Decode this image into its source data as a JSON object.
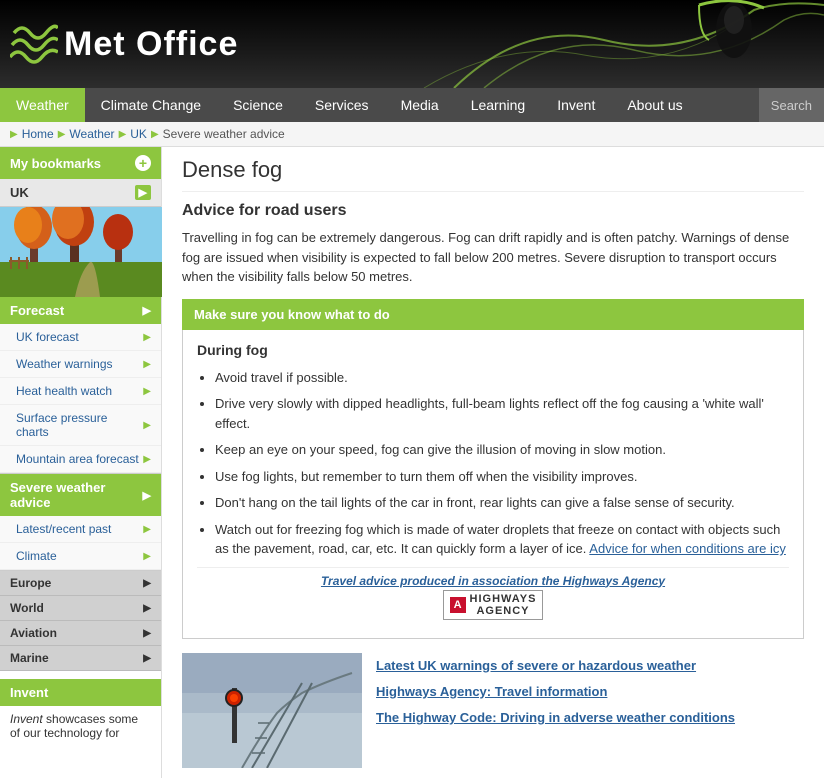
{
  "header": {
    "logo_text": "Met Office",
    "logo_waves": "≋"
  },
  "nav": {
    "items": [
      {
        "label": "Weather",
        "active": true
      },
      {
        "label": "Climate Change",
        "active": false
      },
      {
        "label": "Science",
        "active": false
      },
      {
        "label": "Services",
        "active": false
      },
      {
        "label": "Media",
        "active": false
      },
      {
        "label": "Learning",
        "active": false
      },
      {
        "label": "Invent",
        "active": false
      },
      {
        "label": "About us",
        "active": false
      }
    ],
    "search_label": "Search"
  },
  "breadcrumb": {
    "items": [
      "Home",
      "Weather",
      "UK",
      "Severe weather advice"
    ]
  },
  "sidebar": {
    "bookmarks_label": "My bookmarks",
    "uk_label": "UK",
    "forecast_label": "Forecast",
    "forecast_items": [
      {
        "label": "UK forecast"
      },
      {
        "label": "Weather warnings"
      },
      {
        "label": "Heat health watch"
      },
      {
        "label": "Surface pressure charts"
      },
      {
        "label": "Mountain area forecast"
      }
    ],
    "severe_label": "Severe weather advice",
    "other_items": [
      {
        "label": "Latest/recent past"
      },
      {
        "label": "Climate"
      }
    ],
    "europe_label": "Europe",
    "world_label": "World",
    "aviation_label": "Aviation",
    "marine_label": "Marine",
    "invent_label": "Invent",
    "invent_text": "Invent showcases some of our technology for"
  },
  "main": {
    "page_title": "Dense fog",
    "section_title": "Advice for road users",
    "intro": "Travelling in fog can be extremely dangerous. Fog can drift rapidly and is often patchy. Warnings of dense fog are issued when visibility is expected to fall below 200 metres. Severe disruption to transport occurs when the visibility falls below 50 metres.",
    "banner": "Make sure you know what to do",
    "during_fog_title": "During fog",
    "tips": [
      "Avoid travel if possible.",
      "Drive very slowly with dipped headlights, full-beam lights reflect off the fog causing a 'white wall' effect.",
      "Keep an eye on your speed, fog can give the illusion of moving in slow motion.",
      "Use fog lights, but remember to turn them off when the visibility improves.",
      "Don't hang on the tail lights of the car in front, rear lights can give a false sense of security.",
      "Watch out for freezing fog which is made of water droplets that freeze on contact with objects such as the pavement, road, car, etc. It can quickly form a layer of ice."
    ],
    "icy_link": "Advice for when conditions are icy",
    "highways_credit": "Travel advice produced in association the Highways Agency",
    "links": [
      "Latest UK warnings of severe or hazardous weather",
      "Highways Agency: Travel information",
      "The Highway Code: Driving in adverse weather conditions"
    ]
  }
}
